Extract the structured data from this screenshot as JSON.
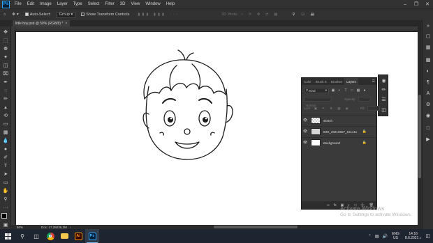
{
  "menubar": {
    "items": [
      "File",
      "Edit",
      "Image",
      "Layer",
      "Type",
      "Select",
      "Filter",
      "3D",
      "View",
      "Window",
      "Help"
    ]
  },
  "options": {
    "auto_select": "Auto-Select:",
    "group": "Group",
    "show_transform": "Show Transform Controls",
    "mode_3d": "3D Mode:"
  },
  "document": {
    "tab": "little boy.psd @ 50% (RGB/8) *",
    "zoom": "50%",
    "doc_info": "Doc: 17,2M/36,2M"
  },
  "layers_panel": {
    "tabs": [
      "Color",
      "Brush S",
      "Brushes",
      "Layers"
    ],
    "active_tab": "Layers",
    "kind": "Kind",
    "blend_mode": "Normal",
    "opacity_label": "Opacity:",
    "lock_label": "Lock:",
    "fill_label": "Fill:",
    "layers": [
      {
        "name": "sketch",
        "visible": true,
        "selected": false,
        "locked": false
      },
      {
        "name": "IMG_20210607_151411",
        "visible": true,
        "selected": false,
        "locked": true
      },
      {
        "name": "Background",
        "visible": true,
        "selected": false,
        "locked": true
      }
    ]
  },
  "watermark": {
    "line1": "Activate Windows",
    "line2": "Go to Settings to activate Windows."
  },
  "taskbar": {
    "lang": "ENG",
    "region": "US",
    "time": "14:16",
    "date": "8.6.2021 г."
  }
}
